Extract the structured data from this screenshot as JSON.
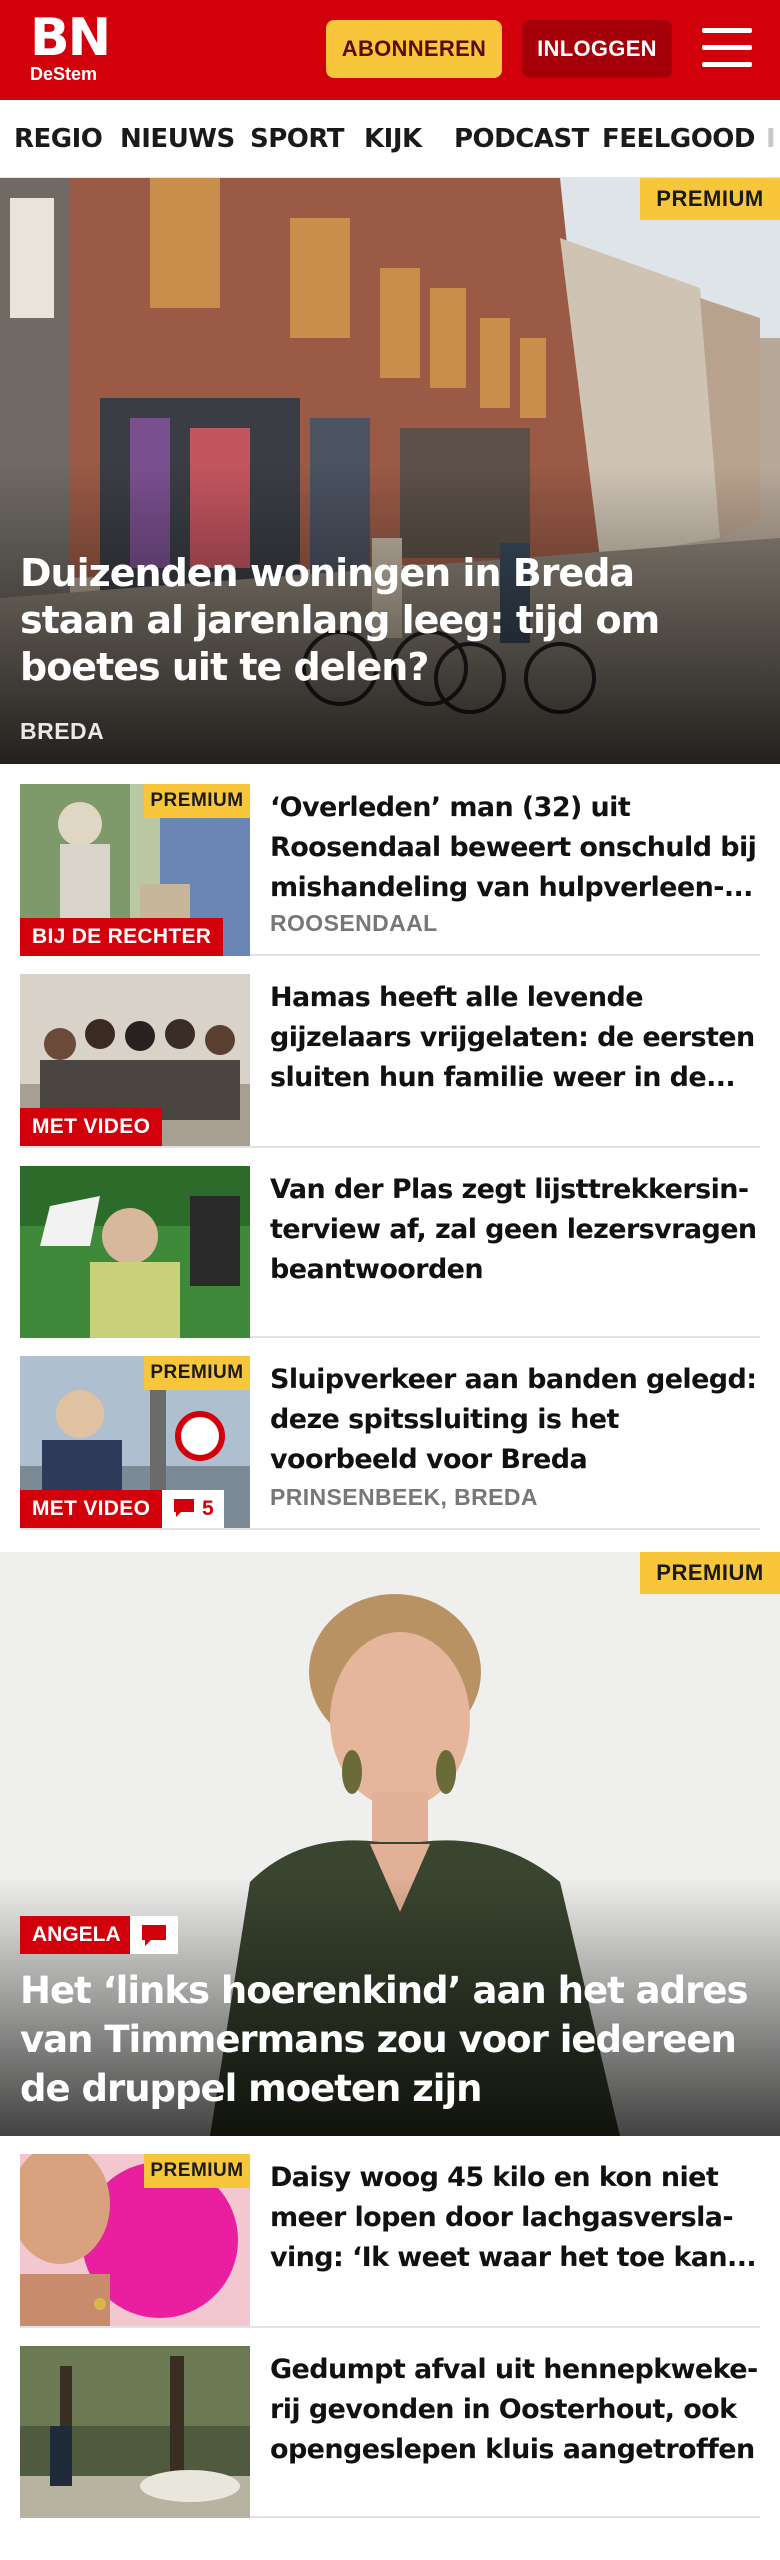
{
  "header": {
    "logo_main": "BN",
    "logo_sub": "DeStem",
    "subscribe_label": "ABONNEREN",
    "login_label": "INLOGGEN",
    "brand_color": "#d1000a",
    "accent_color": "#f7c63b"
  },
  "nav": {
    "items": [
      "REGIO",
      "NIEUWS",
      "SPORT",
      "KIJK",
      "PODCAST",
      "FEELGOOD",
      "I"
    ]
  },
  "hero": {
    "badge": "PREMIUM",
    "title": "Duizenden woningen in Breda staan al jarenlang leeg: tijd om boetes uit te delen?",
    "location": "BREDA"
  },
  "articles": [
    {
      "title": "‘Overleden’ man (32) uit Roosendaal beweert onschuld bij mishandeling van hulpverleen-...",
      "location": "ROOSENDAAL",
      "badge": "PREMIUM",
      "tag": "BIJ DE RECHTER"
    },
    {
      "title": "Hamas heeft alle levende gijzelaars vrijgelaten: de eersten sluiten hun familie weer in de...",
      "tag": "MET VIDEO"
    },
    {
      "title": "Van der Plas zegt lijsttrekkersin-terview af, zal geen lezersvragen beantwoorden"
    },
    {
      "title": "Sluipverkeer aan banden gelegd: deze spitssluiting is het voorbeeld voor Breda",
      "location": "PRINSENBEEK, BREDA",
      "badge": "PREMIUM",
      "tag": "MET VIDEO",
      "comments": "5"
    }
  ],
  "hero2": {
    "badge": "PREMIUM",
    "author": "ANGELA",
    "title": "Het ‘links hoerenkind’ aan het adres van Timmermans zou voor iedereen de druppel moeten zijn"
  },
  "articles2": [
    {
      "title": "Daisy woog 45 kilo en kon niet meer lopen door lachgasversla-ving: ‘Ik weet waar het toe kan...",
      "badge": "PREMIUM"
    },
    {
      "title": "Gedumpt afval uit hennepkweke-rij gevonden in Oosterhout, ook opengeslepen kluis aangetroffen"
    }
  ]
}
